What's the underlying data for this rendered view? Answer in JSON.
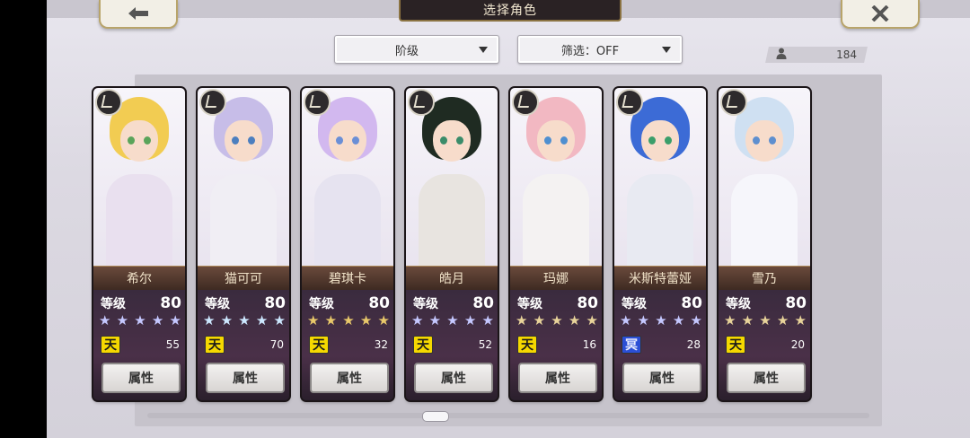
{
  "header": {
    "title": "选择角色"
  },
  "filters": {
    "rank_label": "阶级",
    "filter_label": "筛选：OFF"
  },
  "character_count": "184",
  "colors": {
    "accent_gold": "#b8a46a",
    "rank_sky": "#f5d800",
    "rank_sea": "#2b4fd6"
  },
  "cards": [
    {
      "name": "希尔",
      "level_label": "等级",
      "level": "80",
      "star_color": "#c5c8ff",
      "rank_icon": "天",
      "rank_type": "sky",
      "count": "55",
      "attr_label": "属性",
      "hair": "#f2cc52",
      "eye": "#5aa45a",
      "outfit": "#e9e0ef"
    },
    {
      "name": "猫可可",
      "level_label": "等级",
      "level": "80",
      "star_color": "#cde8ff",
      "rank_icon": "天",
      "rank_type": "sky",
      "count": "70",
      "attr_label": "属性",
      "hair": "#c7bde8",
      "eye": "#4c7fbf",
      "outfit": "#f0eef4"
    },
    {
      "name": "碧琪卡",
      "level_label": "等级",
      "level": "80",
      "star_color": "#e8c86a",
      "rank_icon": "天",
      "rank_type": "sky",
      "count": "32",
      "attr_label": "属性",
      "hair": "#d2b8ef",
      "eye": "#6a8fd6",
      "outfit": "#e6e3f0"
    },
    {
      "name": "皓月",
      "level_label": "等级",
      "level": "80",
      "star_color": "#c5c8ff",
      "rank_icon": "天",
      "rank_type": "sky",
      "count": "52",
      "attr_label": "属性",
      "hair": "#1f2b22",
      "eye": "#3a8c6a",
      "outfit": "#e8e4e0"
    },
    {
      "name": "玛娜",
      "level_label": "等级",
      "level": "80",
      "star_color": "#e8d39a",
      "rank_icon": "天",
      "rank_type": "sky",
      "count": "16",
      "attr_label": "属性",
      "hair": "#f2b8c2",
      "eye": "#4f8fd0",
      "outfit": "#f4f2f2"
    },
    {
      "name": "米斯特蕾娅",
      "level_label": "等级",
      "level": "80",
      "star_color": "#c5c8ff",
      "rank_icon": "冥",
      "rank_type": "sea",
      "count": "28",
      "attr_label": "属性",
      "hair": "#3c6bd6",
      "eye": "#3a9e6a",
      "outfit": "#e8eaf2"
    },
    {
      "name": "雪乃",
      "level_label": "等级",
      "level": "80",
      "star_color": "#e8d39a",
      "rank_icon": "天",
      "rank_type": "sky",
      "count": "20",
      "attr_label": "属性",
      "hair": "#cfe0f2",
      "eye": "#5e8fcf",
      "outfit": "#f6f6fb"
    }
  ]
}
